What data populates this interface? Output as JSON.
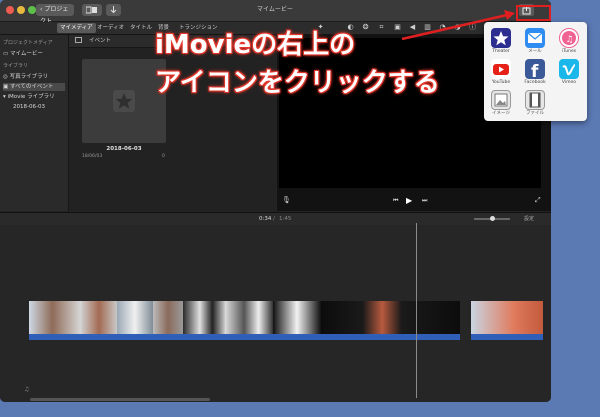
{
  "window": {
    "title": "マイムービー",
    "back_label": "プロジェクト"
  },
  "media_tabs": [
    "マイメディア",
    "オーディオ",
    "タイトル",
    "背景",
    "トランジション"
  ],
  "sidebar": {
    "project_header": "プロジェクトメディア",
    "project_item": "マイムービー",
    "library_header": "ライブラリ",
    "items": [
      "写真ライブラリ",
      "すべてのイベント",
      "iMovie ライブラリ",
      "2018-06-03"
    ]
  },
  "browser": {
    "header": "イベント",
    "clip_title": "2018-06-03",
    "clip_date": "18/06/03",
    "clip_count": "0"
  },
  "timeline": {
    "time_current": "0:34",
    "time_total": "1:45",
    "settings_label": "設定"
  },
  "share_popup": {
    "items": [
      {
        "label": "Theater",
        "icon": "theater-star-icon",
        "color": "#2c2f8f"
      },
      {
        "label": "メール",
        "icon": "mail-icon",
        "color": "#2f8cf0"
      },
      {
        "label": "iTunes",
        "icon": "itunes-icon",
        "color": "#f06292"
      },
      {
        "label": "YouTube",
        "icon": "youtube-icon",
        "color": "#e62117"
      },
      {
        "label": "Facebook",
        "icon": "facebook-icon",
        "color": "#3b5998"
      },
      {
        "label": "Vimeo",
        "icon": "vimeo-icon",
        "color": "#1ab7ea"
      },
      {
        "label": "イメージ",
        "icon": "image-icon",
        "color": "#dddddd"
      },
      {
        "label": "ファイル",
        "icon": "file-film-icon",
        "color": "#dddddd"
      }
    ]
  },
  "annotation": {
    "line1": "iMovieの右上の",
    "line2": "アイコンをクリックする",
    "color": "#e2372c"
  }
}
